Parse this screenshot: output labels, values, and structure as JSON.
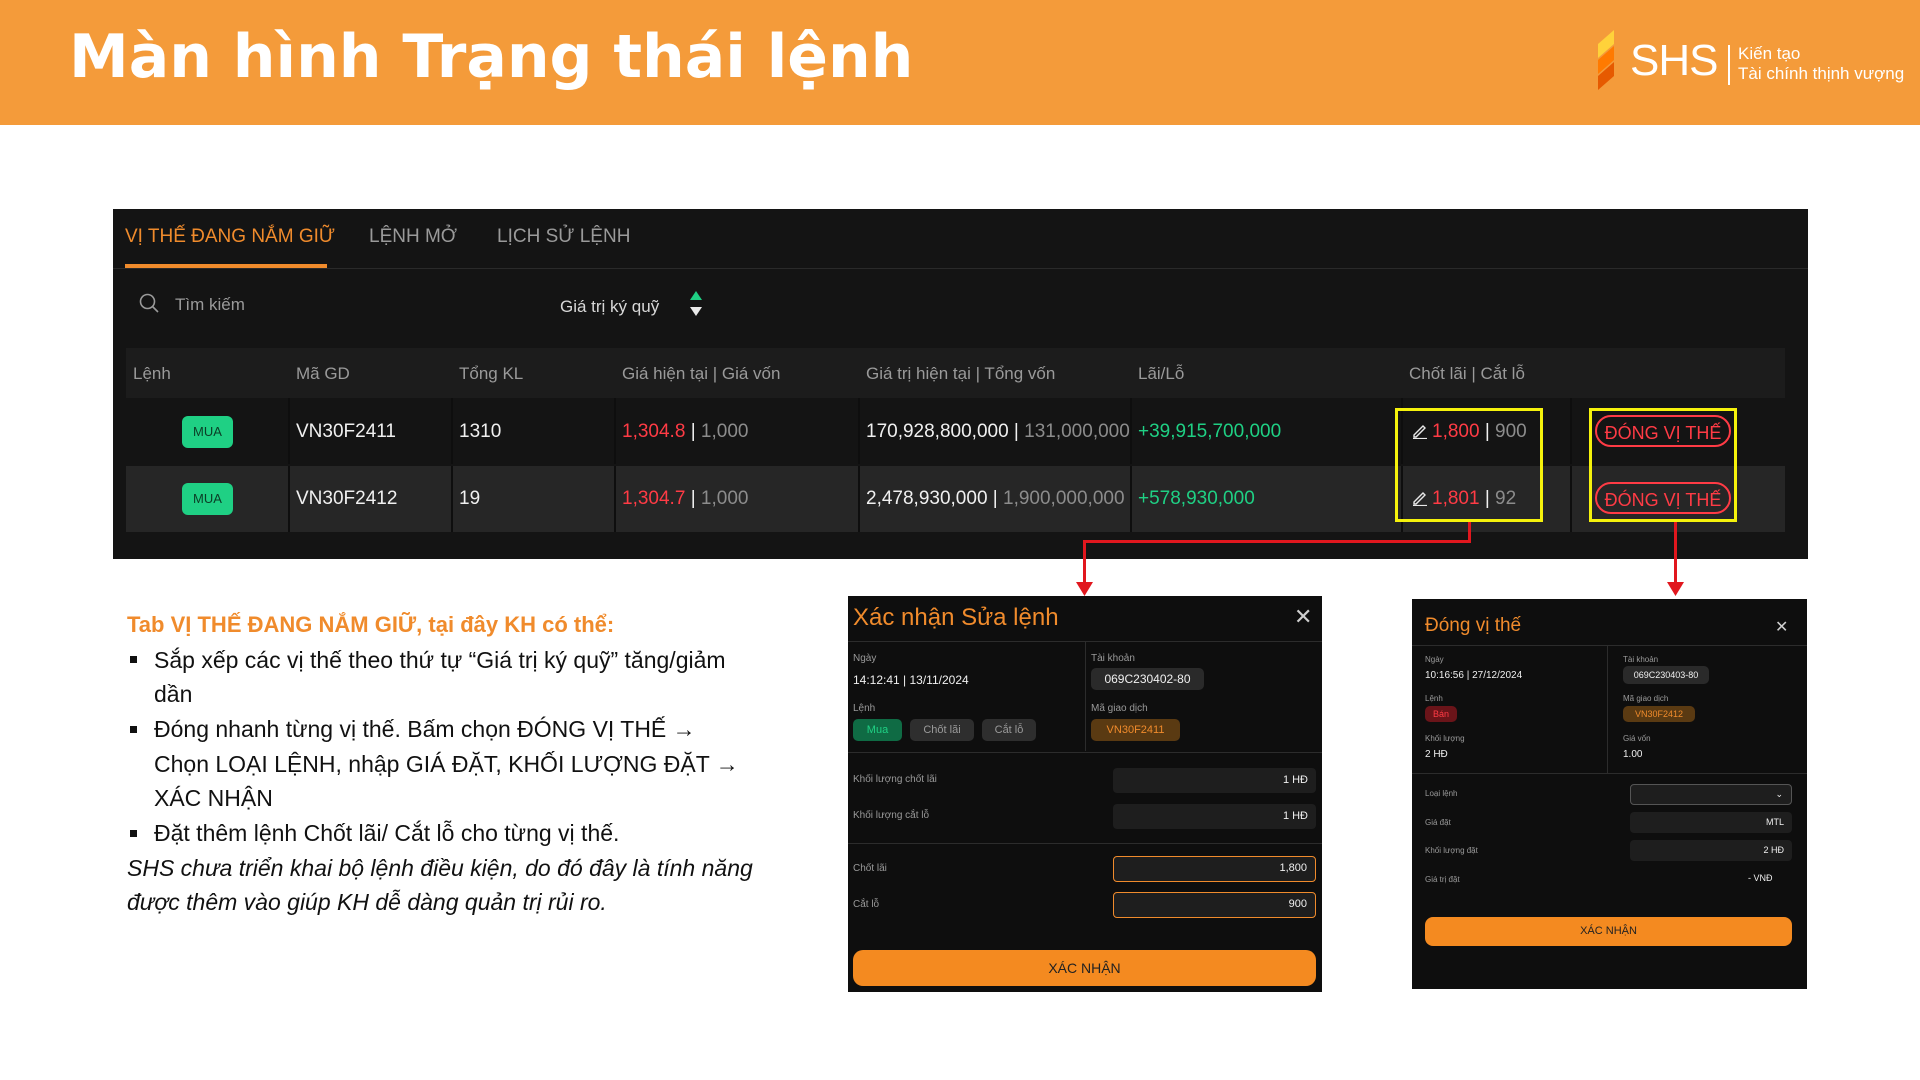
{
  "header": {
    "title": "Màn hình Trạng thái lệnh",
    "logo": {
      "name": "SHS",
      "tagline_1": "Kiến tạo",
      "tagline_2": "Tài chính thịnh vượng"
    }
  },
  "tabs": [
    {
      "label": "VỊ THẾ ĐANG NẮM GIỮ",
      "active": true
    },
    {
      "label": "LỆNH MỞ",
      "active": false
    },
    {
      "label": "LỊCH SỬ LỆNH",
      "active": false
    }
  ],
  "search": {
    "placeholder": "Tìm kiếm",
    "icon": "search-icon"
  },
  "sort": {
    "label": "Giá trị ký quỹ"
  },
  "table": {
    "headers": [
      "Lệnh",
      "Mã GD",
      "Tổng KL",
      "Giá hiện tại | Giá vốn",
      "Giá trị hiện tại | Tổng vốn",
      "Lãi/Lỗ",
      "Chốt lãi | Cắt lỗ"
    ],
    "rows": [
      {
        "side": "MUA",
        "code": "VN30F2411",
        "qty": "1310",
        "price_now": "1,304.8",
        "price_cost": "1,000",
        "value_now": "170,928,800,000",
        "value_cost": "131,000,000,000",
        "pnl": "+39,915,700,000",
        "take_profit": "1,800",
        "stop_loss": "900",
        "action": "ĐÓNG VỊ THẾ"
      },
      {
        "side": "MUA",
        "code": "VN30F2412",
        "qty": "19",
        "price_now": "1,304.7",
        "price_cost": "1,000",
        "value_now": "2,478,930,000",
        "value_cost": "1,900,000,000",
        "pnl": "+578,930,000",
        "take_profit": "1,801",
        "stop_loss": "92",
        "action": "ĐÓNG VỊ THẾ"
      }
    ],
    "separator": "|"
  },
  "notes": {
    "title": "Tab VỊ THẾ ĐANG NẮM GIỮ, tại đây KH có thể:",
    "bullets": [
      [
        "Sắp xếp các vị thế theo thứ tự “Giá trị ký quỹ” tăng/giảm",
        "dần"
      ],
      [
        "Đóng nhanh từng vị thế. Bấm chọn ĐÓNG VỊ THẾ →",
        "Chọn LOẠI LỆNH, nhập GIÁ ĐẶT, KHỐI LƯỢNG ĐẶT →",
        "XÁC NHẬN"
      ],
      [
        "Đặt thêm lệnh Chốt lãi/ Cắt lỗ cho từng vị thế."
      ]
    ],
    "italic": [
      "SHS chưa triển khai bộ lệnh điều kiện, do đó đây là tính năng",
      "được thêm vào giúp KH dễ dàng quản trị rủi ro."
    ]
  },
  "modal_edit": {
    "title": "Xác nhận Sửa lệnh",
    "date_label": "Ngày",
    "date_value": "14:12:41 | 13/11/2024",
    "account_label": "Tài khoản",
    "account_value": "069C230402-80",
    "order_label": "Lệnh",
    "order_pills": [
      "Mua",
      "Chốt lãi",
      "Cắt lỗ"
    ],
    "code_label": "Mã giao dịch",
    "code_value": "VN30F2411",
    "tp_qty_label": "Khối lượng chốt lãi",
    "tp_qty_value": "1 HĐ",
    "sl_qty_label": "Khối lượng cắt lỗ",
    "sl_qty_value": "1 HĐ",
    "tp_label": "Chốt lãi",
    "tp_value": "1,800",
    "sl_label": "Cắt lỗ",
    "sl_value": "900",
    "confirm": "XÁC NHẬN"
  },
  "modal_close": {
    "title": "Đóng vị thế",
    "date_label": "Ngày",
    "date_value": "10:16:56 | 27/12/2024",
    "account_label": "Tài khoản",
    "account_value": "069C230403-80",
    "order_label": "Lệnh",
    "order_value": "Bán",
    "code_label": "Mã giao dịch",
    "code_value": "VN30F2412",
    "qty_label": "Khối lượng",
    "qty_value": "2 HĐ",
    "cost_label": "Giá vốn",
    "cost_value": "1.00",
    "type_label": "Loại lệnh",
    "price_label": "Giá đặt",
    "price_value": "MTL",
    "order_qty_label": "Khối lượng đặt",
    "order_qty_value": "2 HĐ",
    "value_label": "Giá trị đặt",
    "value_value": "- VNĐ",
    "confirm": "XÁC NHẬN"
  },
  "colors": {
    "brand_orange": "#f49b3a",
    "accent_orange": "#f08b2c",
    "buy_green": "#1fd084",
    "loss_red": "#ff3b45",
    "highlight_yellow": "#f5f20c",
    "arrow_red": "#e1171e"
  }
}
